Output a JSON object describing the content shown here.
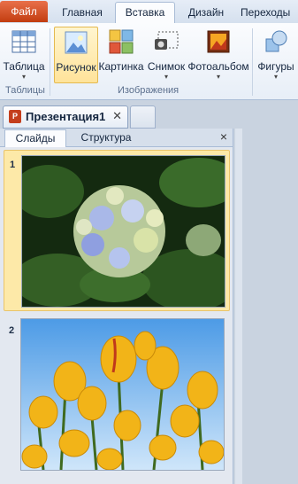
{
  "ribbon_tabs": {
    "file": "Файл",
    "home": "Главная",
    "insert": "Вставка",
    "design": "Дизайн",
    "transitions": "Переходы"
  },
  "ribbon": {
    "table": "Таблица",
    "picture": "Рисунок",
    "clipart": "Картинка",
    "screenshot": "Снимок",
    "photoalbum": "Фотоальбом",
    "shapes": "Фигуры",
    "group_tables": "Таблицы",
    "group_images": "Изображения"
  },
  "document_tab": {
    "title": "Презентация1",
    "app_icon_letter": "P"
  },
  "panel": {
    "tab_slides": "Слайды",
    "tab_outline": "Структура",
    "close": "×"
  },
  "slides": [
    {
      "number": "1",
      "subject": "hydrangea flower",
      "selected": true
    },
    {
      "number": "2",
      "subject": "yellow tulips",
      "selected": false
    }
  ],
  "colors": {
    "file_tab": "#c23d10",
    "selection": "#fde9a8",
    "accent": "#1e395b"
  }
}
